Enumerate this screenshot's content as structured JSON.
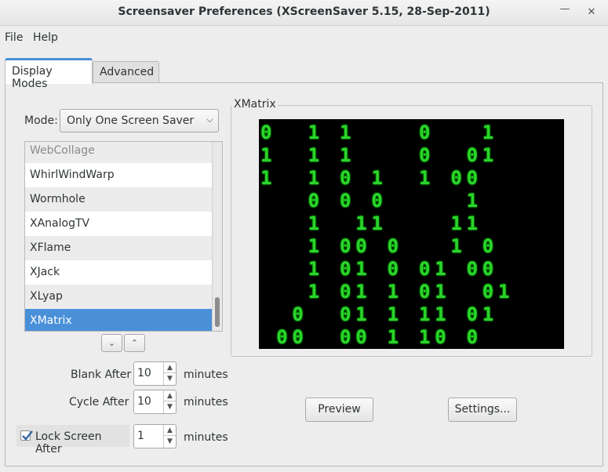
{
  "window": {
    "title": "Screensaver Preferences  (XScreenSaver 5.15, 28-Sep-2011)"
  },
  "menubar": {
    "file": "File",
    "help": "Help"
  },
  "tabs": [
    {
      "label": "Display Modes",
      "active": true
    },
    {
      "label": "Advanced",
      "active": false
    }
  ],
  "mode": {
    "label": "Mode:",
    "value": "Only One Screen Saver"
  },
  "screensavers": [
    {
      "name": "WebCollage",
      "selected": false
    },
    {
      "name": "WhirlWindWarp",
      "selected": false
    },
    {
      "name": "Wormhole",
      "selected": false
    },
    {
      "name": "XAnalogTV",
      "selected": false
    },
    {
      "name": "XFlame",
      "selected": false
    },
    {
      "name": "XJack",
      "selected": false
    },
    {
      "name": "XLyap",
      "selected": false
    },
    {
      "name": "XMatrix",
      "selected": true
    }
  ],
  "settings": {
    "blank_after": {
      "label": "Blank After",
      "value": "10",
      "unit": "minutes"
    },
    "cycle_after": {
      "label": "Cycle After",
      "value": "10",
      "unit": "minutes"
    },
    "lock_screen_after": {
      "label": "Lock Screen After",
      "value": "1",
      "unit": "minutes",
      "checked": true
    }
  },
  "preview": {
    "frame_label": "XMatrix",
    "matrix_rows": [
      "0  1 1    0   1",
      "1  1 1    0  01",
      "1  1 0 1  1 00 ",
      "   0 0 0     1 ",
      "   1  11    11 ",
      "   1 00 0   1 0",
      "   1 01 0 01 00",
      "   1 01 1 01  01",
      "  0  01 1 11 01",
      " 00  00 1 10 0 "
    ]
  },
  "buttons": {
    "preview": "Preview",
    "settings": "Settings..."
  }
}
